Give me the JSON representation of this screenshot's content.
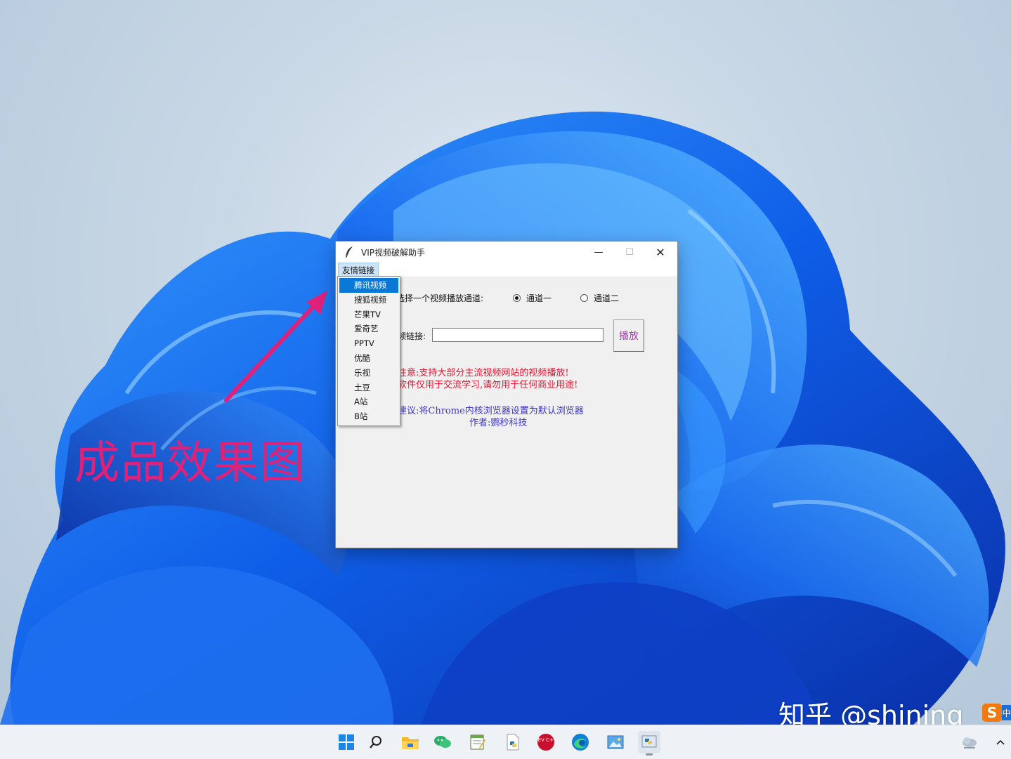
{
  "window": {
    "title": "VIP视频破解助手",
    "min_glyph": "—",
    "max_glyph": "☐",
    "close_glyph": "✕",
    "menu": "友情链接",
    "channel_label": "选择一个视频播放通道:",
    "channel_options": [
      "通道一",
      "通道二"
    ],
    "selected_channel": "通道一",
    "link_label": "频链接:",
    "url_value": "",
    "play_label": "播放",
    "notes_red": [
      "注意:支持大部分主流视频网站的视频播放!",
      "软件仅用于交流学习,请勿用于任何商业用途!"
    ],
    "notes_blue": [
      "建议:将Chrome内核浏览器设置为默认浏览器",
      "作者:鹦秒科技"
    ]
  },
  "dropdown": {
    "items": [
      "腾讯视频",
      "搜狐视频",
      "芒果TV",
      "爱奇艺",
      "PPTV",
      "优酷",
      "乐视",
      "土豆",
      "A站",
      "B站"
    ],
    "selected": "腾讯视频"
  },
  "annotation": {
    "text": "成品效果图",
    "color": "#e0217a"
  },
  "watermark": {
    "text": "知乎 @shining",
    "logo": "S",
    "logo2": "中"
  },
  "taskbar": {
    "icons": [
      "windows-start-icon",
      "search-icon",
      "file-explorer-icon",
      "wechat-icon",
      "notepad-icon",
      "python-file-icon",
      "devcpp-icon",
      "edge-icon",
      "image-viewer-icon",
      "python-app-icon"
    ],
    "dev_label": "DEV C++",
    "tray": [
      "weather-icon",
      "chevron-up-icon"
    ]
  },
  "colors": {
    "accent": "#0a78d7",
    "note_red": "#e8122f",
    "note_blue": "#3e35d0",
    "play_text": "#a03fb0"
  }
}
